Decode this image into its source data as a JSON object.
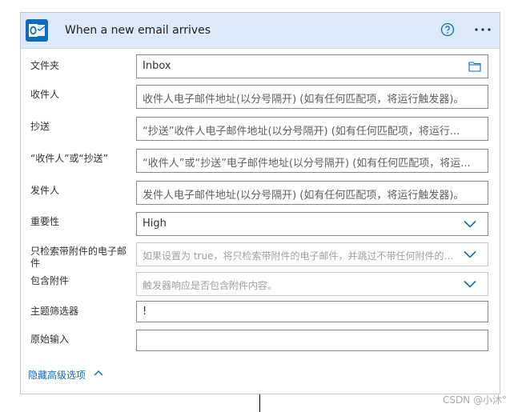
{
  "trigger": {
    "title": "When a new email arrives",
    "app_icon": "outlook-icon",
    "brand_color": "#0f6cbd",
    "header_color": "#dbe9f8"
  },
  "fields": [
    {
      "label": "文件夹",
      "value": "Inbox",
      "placeholder": "",
      "icon": "folder-icon"
    },
    {
      "label": "收件人",
      "value": "",
      "placeholder": "收件人电子邮件地址(以分号隔开) (如有任何匹配项，将运行触发器)。",
      "icon": ""
    },
    {
      "label": "抄送",
      "value": "",
      "placeholder": "“抄送”收件人电子邮件地址(以分号隔开) (如有任何匹配项，将运行...",
      "icon": ""
    },
    {
      "label": "“收件人”或“抄送”",
      "value": "",
      "placeholder": "“收件人”或“抄送”电子邮件地址(以分号隔开) (如有任何匹配项，将运...",
      "icon": ""
    },
    {
      "label": "发件人",
      "value": "",
      "placeholder": "发件人电子邮件地址(以分号隔开) (如有任何匹配项，将运行触发器)。",
      "icon": ""
    },
    {
      "label": "重要性",
      "value": "High",
      "placeholder": "",
      "icon": "chevron-down-icon"
    },
    {
      "label": "只检索带附件的电子邮件",
      "value": "",
      "placeholder": "如果设置为 true，将只检索带附件的电子邮件，并跳过不带任何附件的电子",
      "icon": "chevron-down-icon"
    },
    {
      "label": "包含附件",
      "value": "",
      "placeholder": "触发器响应是否包含附件内容。",
      "icon": "chevron-down-icon"
    },
    {
      "label": "主题筛选器",
      "value": "!",
      "placeholder": "",
      "icon": ""
    },
    {
      "label": "原始输入",
      "value": "",
      "placeholder": "",
      "icon": ""
    }
  ],
  "advanced_toggle": "隐藏高级选项",
  "watermark": "CSDN @小沐°"
}
